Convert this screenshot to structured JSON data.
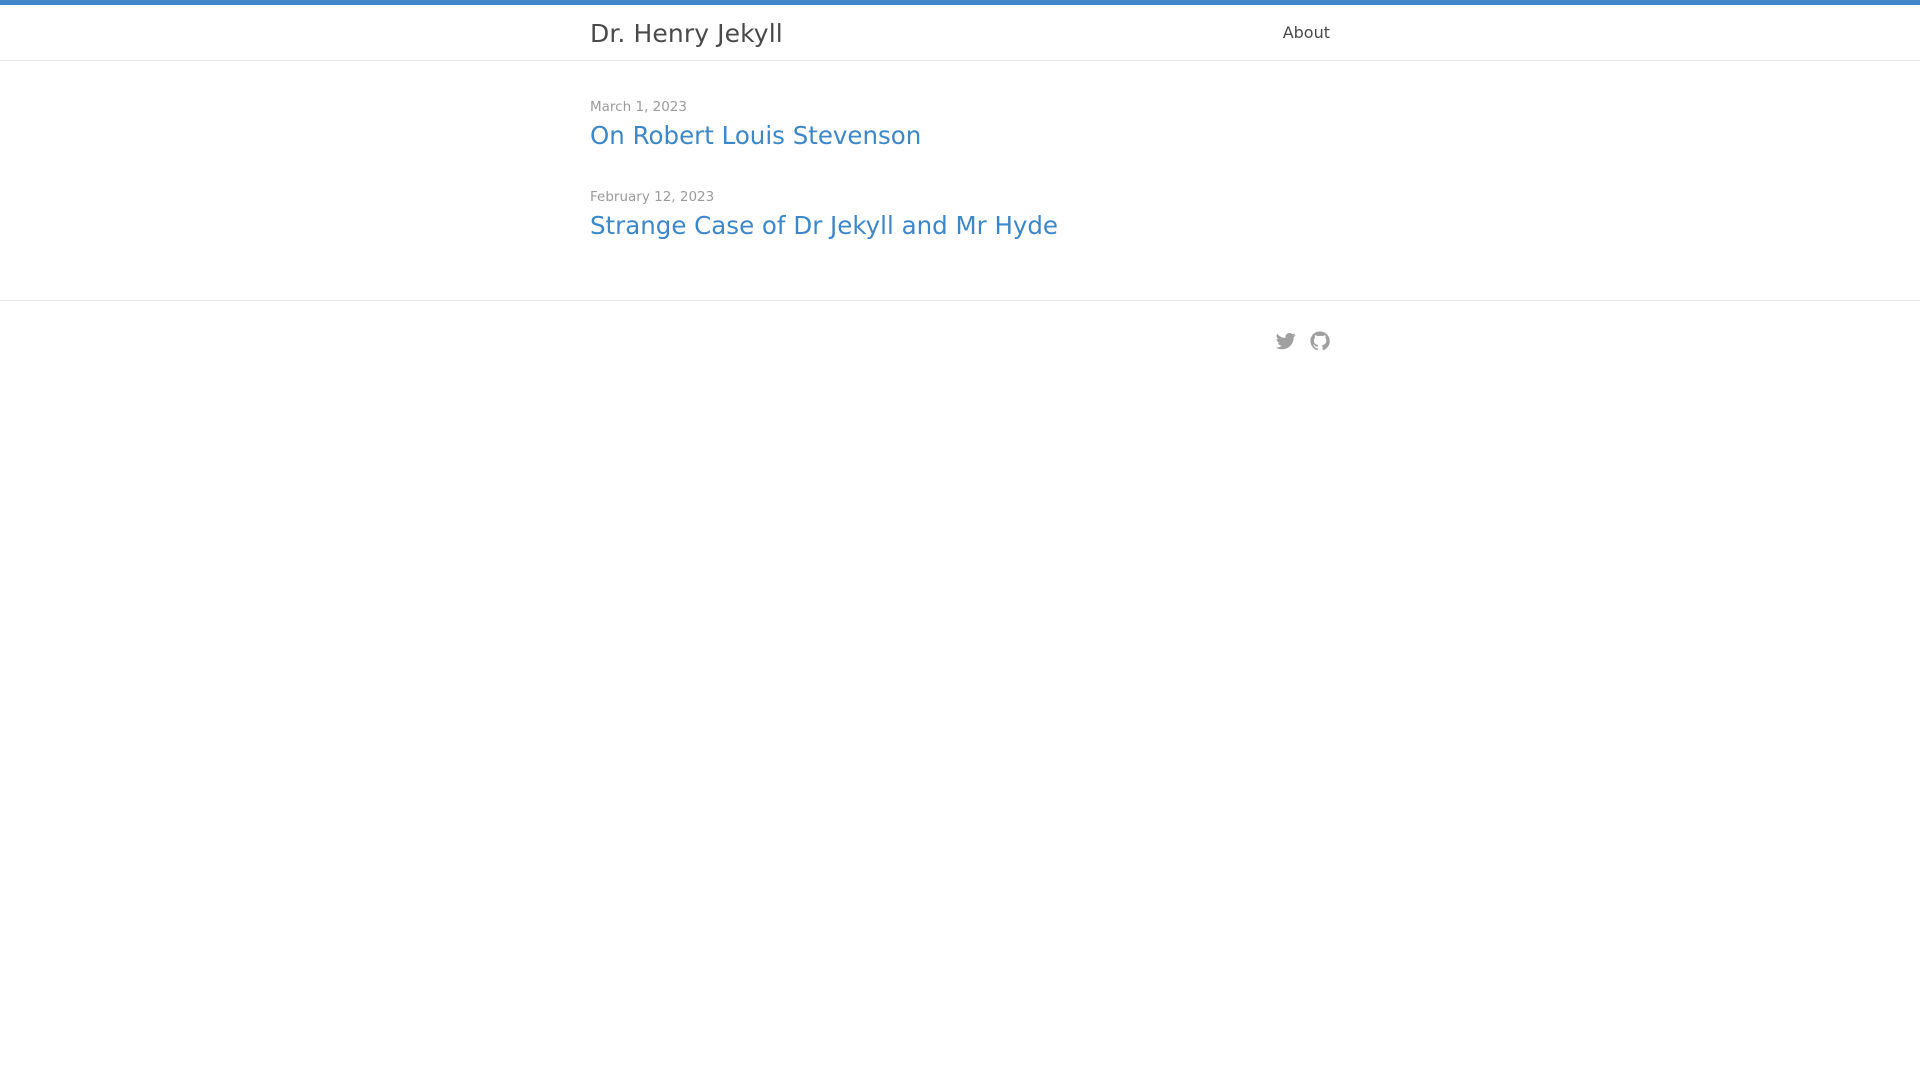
{
  "header": {
    "site_title": "Dr. Henry Jekyll",
    "nav": [
      {
        "label": "About"
      }
    ]
  },
  "posts": [
    {
      "date": "March 1, 2023",
      "title": "On Robert Louis Stevenson"
    },
    {
      "date": "February 12, 2023",
      "title": "Strange Case of Dr Jekyll and Mr Hyde"
    }
  ],
  "footer": {
    "social": [
      {
        "icon": "twitter-icon"
      },
      {
        "icon": "github-icon"
      }
    ]
  },
  "colors": {
    "accent": "#4285c9",
    "link": "#3d87c9",
    "text": "#4a4a4a",
    "muted": "#9b9b9b",
    "icon": "#a0a0a0"
  }
}
